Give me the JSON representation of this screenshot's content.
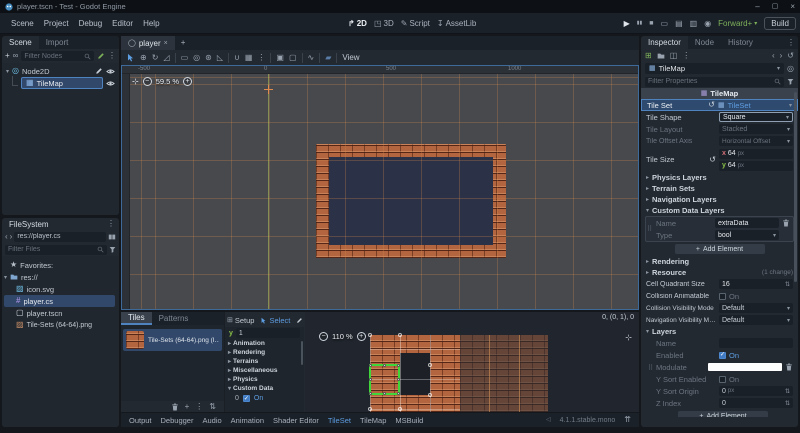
{
  "window": {
    "title": "player.tscn - Test - Godot Engine"
  },
  "menubar": {
    "items": [
      "Scene",
      "Project",
      "Debug",
      "Editor",
      "Help"
    ]
  },
  "workspaces": {
    "w2d": "2D",
    "w3d": "3D",
    "wscript": "Script",
    "wassetlib": "AssetLib"
  },
  "run_bar": {
    "renderer": "Forward+",
    "build": "Build"
  },
  "scene_dock": {
    "tab_scene": "Scene",
    "tab_import": "Import",
    "filter_placeholder": "Filter Nodes",
    "root_node": "Node2D",
    "child_node": "TileMap"
  },
  "filesystem_dock": {
    "title": "FileSystem",
    "path": "res://player.cs",
    "filter_placeholder": "Filter Files",
    "favorites_label": "Favorites:",
    "root_label": "res://",
    "files": [
      "icon.svg",
      "player.cs",
      "player.tscn",
      "Tile-Sets (64-64).png"
    ]
  },
  "canvas": {
    "scene_tab": "player",
    "view_menu": "View",
    "zoom": "59.5 %",
    "ruler_labels": [
      "-500",
      "0",
      "500",
      "1000"
    ]
  },
  "tileset_editor": {
    "tab_tiles": "Tiles",
    "tab_patterns": "Patterns",
    "source_item": "Tile-Sets (64-64).png (I...",
    "toolbar": {
      "setup": "Setup",
      "select": "Select",
      "paint": "Paint"
    },
    "props": {
      "y_label": "y",
      "y_value": "1",
      "sections": [
        "Animation",
        "Rendering",
        "Terrains",
        "Miscellaneous",
        "Physics",
        "Custom Data"
      ],
      "custom_index": "0",
      "custom_value": "On"
    },
    "zoom": "110 %",
    "tile_info": "0, (0, 1), 0"
  },
  "bottom_bar": {
    "items": [
      "Output",
      "Debugger",
      "Audio",
      "Animation",
      "Shader Editor",
      "TileSet",
      "TileMap",
      "MSBuild"
    ],
    "active_item": "TileSet",
    "version": "4.1.1.stable.mono"
  },
  "inspector": {
    "tabs": {
      "inspector": "Inspector",
      "node": "Node",
      "history": "History"
    },
    "node_name": "TileMap",
    "filter_placeholder": "Filter Properties",
    "section_title": "TileMap",
    "rows": {
      "tile_set": {
        "label": "Tile Set",
        "value": "TileSet"
      },
      "tile_shape": {
        "label": "Tile Shape",
        "value": "Square"
      },
      "tile_layout": {
        "label": "Tile Layout",
        "value": "Stacked"
      },
      "tile_offset_axis": {
        "label": "Tile Offset Axis",
        "value": "Horizontal Offset"
      },
      "tile_size": {
        "label": "Tile Size",
        "x_label": "x",
        "x_value": "64",
        "y_label": "y",
        "y_value": "64",
        "unit": "px"
      },
      "cell_quadrant_size": {
        "label": "Cell Quadrant Size",
        "value": "16"
      },
      "collision_animatable": {
        "label": "Collision Animatable",
        "value": "On"
      },
      "collision_visibility": {
        "label": "Collision Visibility Mode",
        "value": "Default"
      },
      "navigation_visibility": {
        "label": "Navigation Visibility Mo...",
        "value": "Default"
      }
    },
    "groups": {
      "physics_layers": "Physics Layers",
      "terrain_sets": "Terrain Sets",
      "navigation_layers": "Navigation Layers",
      "custom_data_layers": "Custom Data Layers",
      "rendering": "Rendering",
      "resource": "Resource",
      "resource_note": "(1 change)",
      "layers": "Layers"
    },
    "custom_data": {
      "name_label": "Name",
      "name_value": "extraData",
      "type_label": "Type",
      "type_value": "bool",
      "add_element": "Add Element"
    },
    "layers": {
      "name_label": "Name",
      "enabled_label": "Enabled",
      "enabled_value": "On",
      "modulate_label": "Modulate",
      "y_sort_enabled_label": "Y Sort Enabled",
      "y_sort_enabled_value": "On",
      "y_sort_origin_label": "Y Sort Origin",
      "y_sort_origin_value": "0",
      "y_sort_origin_unit": "px",
      "z_index_label": "Z Index",
      "z_index_value": "0",
      "add_element": "Add Element"
    }
  },
  "icons": {
    "add": "+",
    "chain": "∞",
    "menu_dots": "⋮",
    "close": "×",
    "minimize": "–",
    "maximize": "▢",
    "play": "▶",
    "pause": "▮▮",
    "stop": "■",
    "remote": "▭",
    "movie": "▤",
    "movie2": "▥",
    "screen": "◉",
    "chevron_down": "▾",
    "chevron_right": "▸",
    "back": "‹",
    "forward": "›",
    "history": "↺",
    "revert": "↺",
    "stepper": "⇅",
    "expand": "⇈",
    "star": "★",
    "scene_circle": "◯",
    "node2d": "◎",
    "tilemap_grid": "▦",
    "image_file": "▨",
    "csharp": "#",
    "scene_file": "▢",
    "move": "⊕",
    "rotate": "↻",
    "scale": "◿",
    "pivot": "◎",
    "pan": "⊛",
    "ruler": "◺",
    "magnet": "∪",
    "grid": "▦",
    "lock": "▣",
    "unlock": "▢",
    "bone": "∿",
    "paint_blue": "▰",
    "save": "◫",
    "new_resource": "⊞",
    "pin": "◎",
    "speaker": "◁",
    "w2d": "↱",
    "w3d": "◳",
    "wscript": "✎",
    "wassetlib": "↧",
    "crosshair": "⊹",
    "minus": "−",
    "plus": "+"
  },
  "colors": {
    "accent_blue": "#5d9de2",
    "selection": "#31486b",
    "renderer_green": "#7db05a",
    "grid_orange": "#d98a4b",
    "brick": "#b2653e",
    "tilemap_interior": "#2b3147",
    "selection_green": "#3fd63a",
    "focus_border": "#3d6a99"
  }
}
